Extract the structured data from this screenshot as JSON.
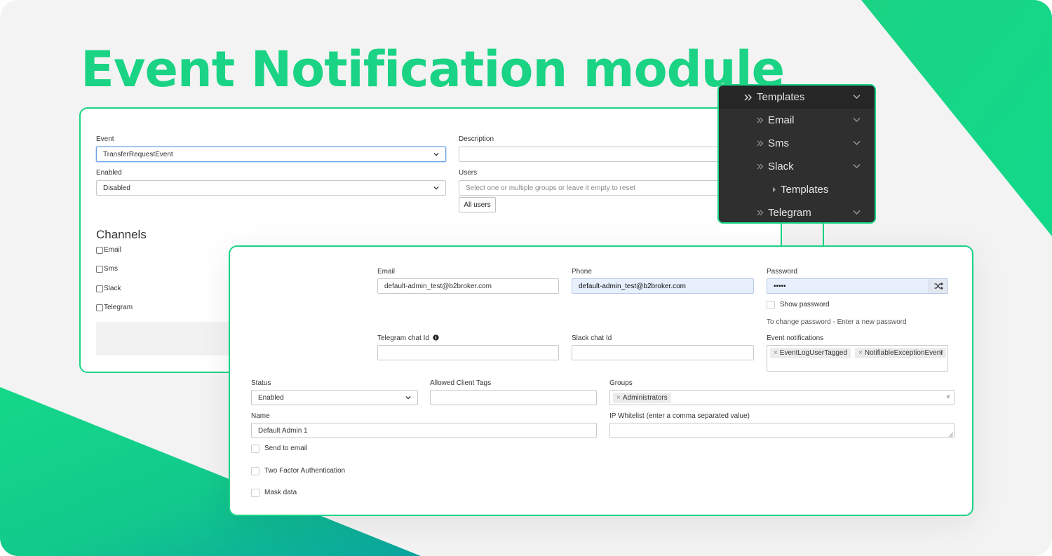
{
  "title": "Event Notification module",
  "colors": {
    "accent": "#1ad384",
    "accent_dark": "#0ea09a",
    "menu_bg": "#2f2f2f"
  },
  "event_form": {
    "event_label": "Event",
    "event_value": "TransferRequestEvent",
    "description_label": "Description",
    "enabled_label": "Enabled",
    "enabled_value": "Disabled",
    "users_label": "Users",
    "users_placeholder": "Select one or multiple groups or leave it empty to reset",
    "all_users_button": "All users",
    "channels_title": "Channels",
    "channels": [
      "Email",
      "Sms",
      "Slack",
      "Telegram"
    ]
  },
  "templates_menu": {
    "items": [
      {
        "label": "Templates",
        "icon": "double-chevron-right-icon",
        "expand_icon": "chevron-down-icon"
      },
      {
        "label": "Email",
        "icon": "double-chevron-right-icon",
        "expand_icon": "chevron-down-icon"
      },
      {
        "label": "Sms",
        "icon": "double-chevron-right-icon",
        "expand_icon": "chevron-down-icon"
      },
      {
        "label": "Slack",
        "icon": "double-chevron-right-icon",
        "expand_icon": "chevron-down-icon"
      },
      {
        "label": "Templates",
        "icon": "caret-right-icon"
      },
      {
        "label": "Telegram",
        "icon": "double-chevron-right-icon",
        "expand_icon": "chevron-down-icon"
      }
    ]
  },
  "admin_form": {
    "email_label": "Email",
    "email_value": "default-admin_test@b2broker.com",
    "phone_label": "Phone",
    "phone_value": "default-admin_test@b2broker.com",
    "password_label": "Password",
    "password_value": "•••••",
    "show_password_label": "Show password",
    "password_hint": "To change password - Enter a new password",
    "telegram_label": "Telegram chat Id",
    "slack_label": "Slack chat Id",
    "event_notifications_label": "Event notifications",
    "event_notifications_tags": [
      "EventLogUserTagged",
      "NotifiableExceptionEvent"
    ],
    "status_label": "Status",
    "status_value": "Enabled",
    "allowed_tags_label": "Allowed Client Tags",
    "groups_label": "Groups",
    "groups_tags": [
      "Administrators"
    ],
    "name_label": "Name",
    "name_value": "Default Admin 1",
    "ip_label": "IP Whitelist (enter a comma separated value)",
    "send_email_label": "Send to email",
    "two_factor_label": "Two Factor Authentication",
    "mask_data_label": "Mask data",
    "remove_symbol": "×"
  }
}
